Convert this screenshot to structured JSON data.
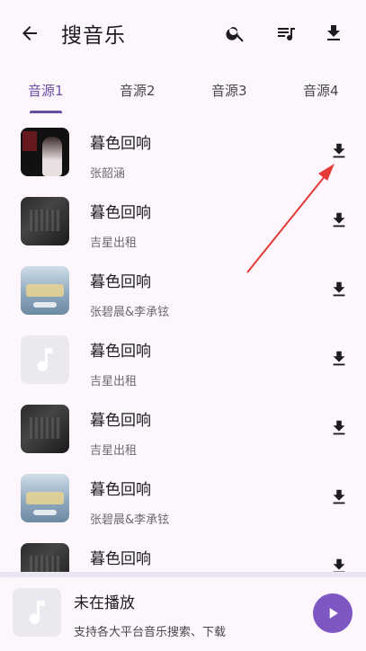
{
  "header": {
    "title": "搜音乐",
    "back_icon": "arrow-back-icon",
    "actions": [
      "search-icon",
      "playlist-icon",
      "download-icon"
    ]
  },
  "tabs": [
    {
      "label": "音源1",
      "active": true
    },
    {
      "label": "音源2",
      "active": false
    },
    {
      "label": "音源3",
      "active": false
    },
    {
      "label": "音源4",
      "active": false
    }
  ],
  "results": [
    {
      "title": "暮色回响",
      "artist": "张韶涵",
      "thumb": "portrait"
    },
    {
      "title": "暮色回响",
      "artist": "吉星出租",
      "thumb": "dark"
    },
    {
      "title": "暮色回响",
      "artist": "张碧晨&李承铉",
      "thumb": "show"
    },
    {
      "title": "暮色回响",
      "artist": "吉星出租",
      "thumb": "empty"
    },
    {
      "title": "暮色回响",
      "artist": "吉星出租",
      "thumb": "dark"
    },
    {
      "title": "暮色回响",
      "artist": "张碧晨&李承铉",
      "thumb": "show"
    },
    {
      "title": "暮色回响",
      "artist": "",
      "thumb": "dark"
    }
  ],
  "player": {
    "title": "未在播放",
    "subtitle": "支持各大平台音乐搜索、下载"
  },
  "colors": {
    "accent": "#6750a4",
    "play_button": "#7e57c2",
    "annotation_arrow": "#e53935",
    "background": "#fdf7fd"
  }
}
